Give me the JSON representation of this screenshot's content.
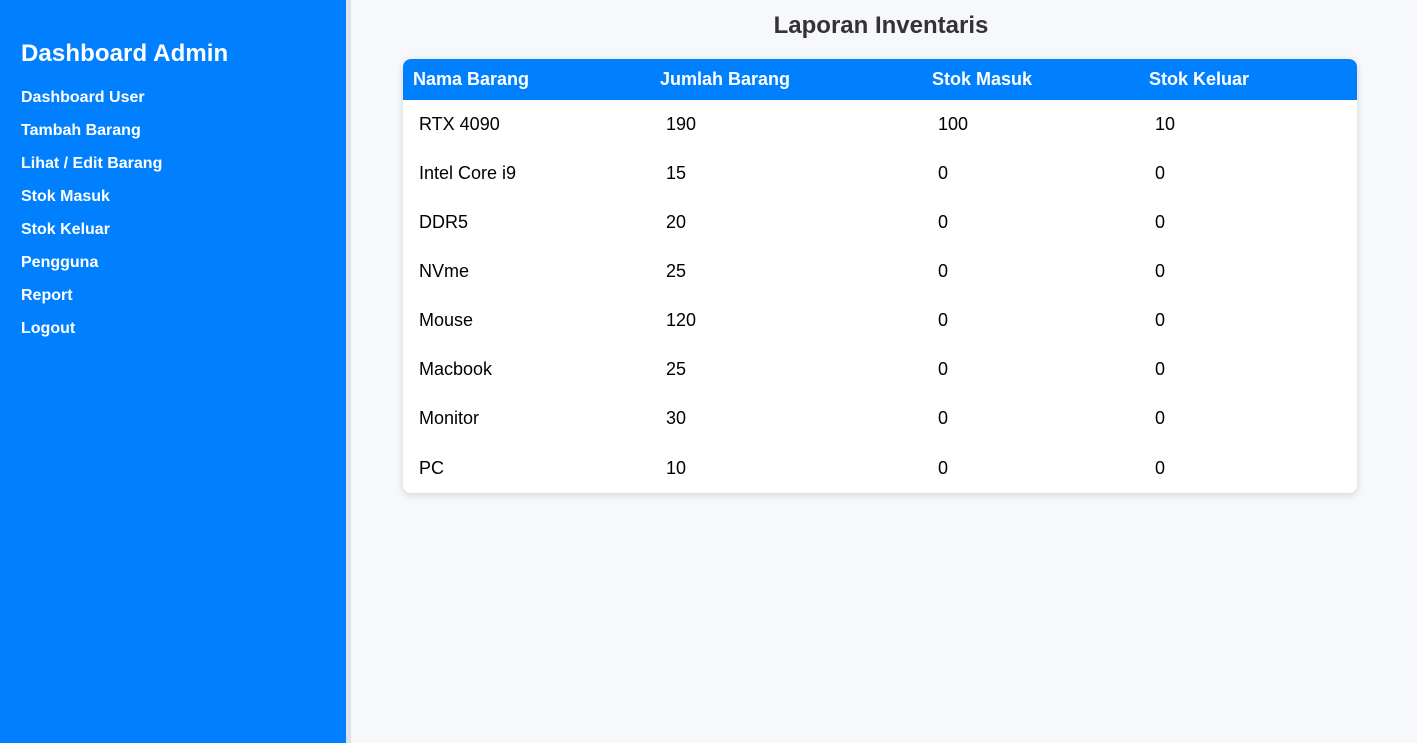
{
  "sidebar": {
    "title": "Dashboard Admin",
    "items": [
      {
        "label": "Dashboard User"
      },
      {
        "label": "Tambah Barang"
      },
      {
        "label": "Lihat / Edit Barang"
      },
      {
        "label": "Stok Masuk"
      },
      {
        "label": "Stok Keluar"
      },
      {
        "label": "Pengguna"
      },
      {
        "label": "Report"
      },
      {
        "label": "Logout"
      }
    ]
  },
  "main": {
    "title": "Laporan Inventaris",
    "table": {
      "headers": [
        "Nama Barang",
        "Jumlah Barang",
        "Stok Masuk",
        "Stok Keluar"
      ],
      "rows": [
        [
          "RTX 4090",
          "190",
          "100",
          "10"
        ],
        [
          "Intel Core i9",
          "15",
          "0",
          "0"
        ],
        [
          "DDR5",
          "20",
          "0",
          "0"
        ],
        [
          "NVme",
          "25",
          "0",
          "0"
        ],
        [
          "Mouse",
          "120",
          "0",
          "0"
        ],
        [
          "Macbook",
          "25",
          "0",
          "0"
        ],
        [
          "Monitor",
          "30",
          "0",
          "0"
        ],
        [
          "PC",
          "10",
          "0",
          "0"
        ]
      ]
    }
  },
  "colors": {
    "accent": "#0080ff",
    "page_background": "#f7f8fc",
    "title_text": "#333333"
  }
}
